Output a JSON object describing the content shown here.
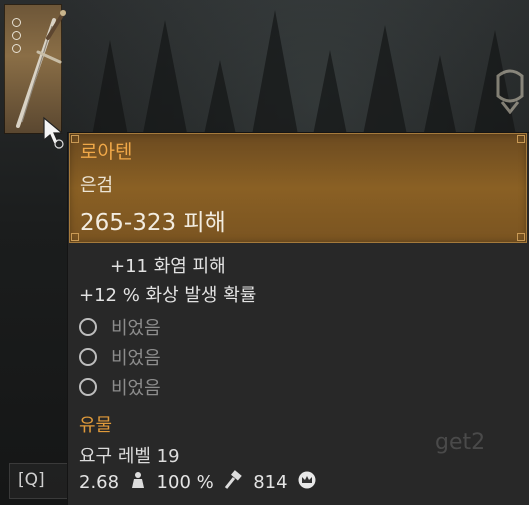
{
  "tooltip": {
    "name": "로아텐",
    "type": "은검",
    "damage": "265-323 피해",
    "stats": [
      "+11  화염 피해",
      "+12 %  화상 발생 확률"
    ],
    "sockets": [
      "비었음",
      "비었음",
      "비었음"
    ],
    "rarity": "유물",
    "requirement": "요구 레벨 19",
    "weight": "2.68",
    "durability": "100 %",
    "price": "814"
  },
  "keybind": {
    "key": "[Q]"
  },
  "watermark": "get2",
  "colors": {
    "name": "#f0a848",
    "rarity": "#e09a3a",
    "header_bg": "#7a5421",
    "panel_bg": "#282828"
  },
  "icons": [
    "weight-icon",
    "hammer-icon",
    "crown-coin-icon",
    "sword-icon",
    "gauntlet-icon",
    "cursor-icon"
  ]
}
